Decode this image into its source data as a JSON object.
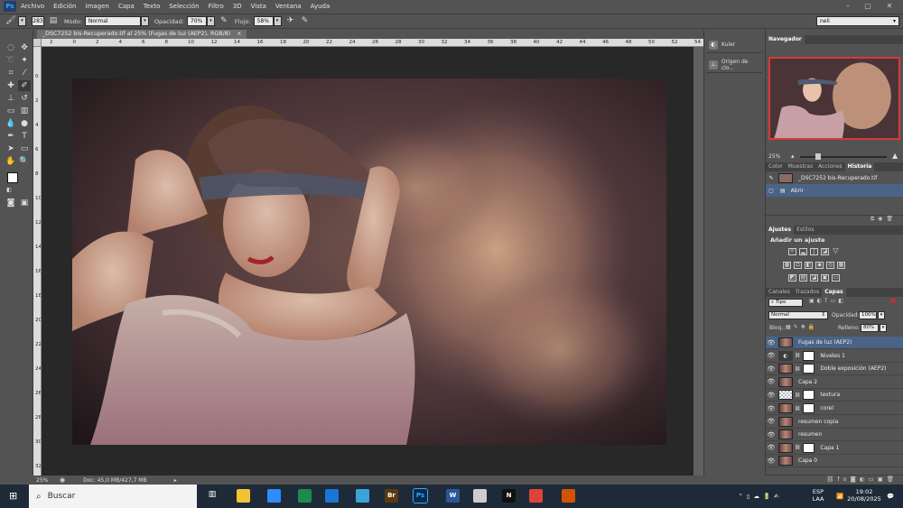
{
  "app": {
    "logo": "Ps"
  },
  "menu": [
    "Archivo",
    "Edición",
    "Imagen",
    "Capa",
    "Texto",
    "Selección",
    "Filtro",
    "3D",
    "Vista",
    "Ventana",
    "Ayuda"
  ],
  "options_bar": {
    "brush_size": "283",
    "mode_label": "Modo:",
    "mode_value": "Normal",
    "opacity_label": "Opacidad:",
    "opacity_value": "70%",
    "flow_label": "Flujo:",
    "flow_value": "58%",
    "workspace": "neli"
  },
  "document": {
    "tab_title": "_DSC7252 bis-Recuperado.tif al 25% (Fugas de luz (AEP2), RGB/8)",
    "close": "×",
    "zoom": "25%",
    "doc_info": "Doc: 45,0 MB/427,7 MB"
  },
  "rulers": {
    "horizontal": [
      "2",
      "0",
      "2",
      "4",
      "6",
      "8",
      "10",
      "12",
      "14",
      "16",
      "18",
      "20",
      "22",
      "24",
      "26",
      "28",
      "30",
      "32",
      "34",
      "36",
      "38",
      "40",
      "42",
      "44",
      "46",
      "48",
      "50",
      "52",
      "54"
    ],
    "vertical": [
      "0",
      "2",
      "4",
      "6",
      "8",
      "10",
      "12",
      "14",
      "16",
      "18",
      "20",
      "22",
      "24",
      "26",
      "28",
      "30",
      "32"
    ]
  },
  "mini_panels": [
    {
      "label": "Kuler",
      "icon": "kuler-icon"
    },
    {
      "label": "Origen de clo...",
      "icon": "clone-source-icon"
    }
  ],
  "navigator": {
    "tab": "Navegador",
    "zoom": "25%"
  },
  "history_panel": {
    "tabs": [
      "Color",
      "Muestras",
      "Acciones",
      "Historia"
    ],
    "active_tab": "Historia",
    "snapshot": "_DSC7252 bis-Recuperado.tif",
    "items": [
      "Abrir"
    ]
  },
  "adjustments_panel": {
    "tabs": [
      "Ajustes",
      "Estilos"
    ],
    "active_tab": "Ajustes",
    "title": "Añadir un ajuste"
  },
  "layers_panel": {
    "tabs": [
      "Canales",
      "Trazados",
      "Capas"
    ],
    "active_tab": "Capas",
    "filter": "Tipo",
    "blend_mode": "Normal",
    "opacity_label": "Opacidad:",
    "opacity_value": "100%",
    "lock_label": "Bloq.:",
    "fill_label": "Relleno:",
    "fill_value": "80%",
    "layers": [
      {
        "name": "Fugas de luz (AEP2)",
        "selected": true,
        "thumb": "photo",
        "mask": false
      },
      {
        "name": "Niveles 1",
        "selected": false,
        "thumb": "adjust",
        "mask": true
      },
      {
        "name": "Doble exposición (AEP2)",
        "selected": false,
        "thumb": "photo",
        "mask": true
      },
      {
        "name": "Capa 2",
        "selected": false,
        "thumb": "photo",
        "mask": false
      },
      {
        "name": "textura",
        "selected": false,
        "thumb": "checker",
        "mask": true
      },
      {
        "name": "corel",
        "selected": false,
        "thumb": "photo",
        "mask": true
      },
      {
        "name": "resumen copia",
        "selected": false,
        "thumb": "photo",
        "mask": false
      },
      {
        "name": "resumen",
        "selected": false,
        "thumb": "photo",
        "mask": false
      },
      {
        "name": "Capa 1",
        "selected": false,
        "thumb": "photo",
        "mask": true
      },
      {
        "name": "Capa 0",
        "selected": false,
        "thumb": "photo",
        "mask": false
      }
    ]
  },
  "taskbar": {
    "search_placeholder": "Buscar",
    "apps": [
      {
        "label": "",
        "icon": "file-explorer-icon",
        "color": "#f1c232"
      },
      {
        "label": "",
        "icon": "zoom-icon",
        "color": "#2d8cff"
      },
      {
        "label": "",
        "icon": "excel-icon",
        "color": "#1d8a4e"
      },
      {
        "label": "",
        "icon": "outlook-icon",
        "color": "#1976d2"
      },
      {
        "label": "",
        "icon": "notepad-icon",
        "color": "#3ba3d9"
      },
      {
        "label": "Br",
        "icon": "bridge-icon",
        "color": "#5a3b10"
      },
      {
        "label": "Ps",
        "icon": "photoshop-icon",
        "color": "#0b2a4a"
      },
      {
        "label": "W",
        "icon": "word-icon",
        "color": "#2b5797"
      },
      {
        "label": "",
        "icon": "paint-icon",
        "color": "#ccc"
      },
      {
        "label": "N",
        "icon": "netflix-icon",
        "color": "#111"
      },
      {
        "label": "",
        "icon": "chrome-icon",
        "color": "#db4437"
      },
      {
        "label": "",
        "icon": "spark-icon",
        "color": "#d35400"
      }
    ],
    "language_top": "ESP",
    "language_bottom": "LAA",
    "time": "19:02",
    "date": "20/08/2025"
  }
}
